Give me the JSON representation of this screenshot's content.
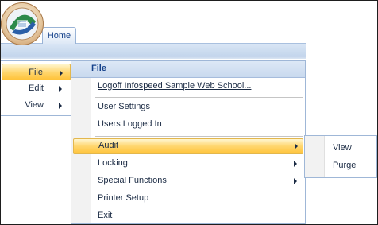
{
  "ribbon": {
    "tab_home_label": "Home"
  },
  "left_menu": {
    "items": [
      {
        "label": "File",
        "highlighted": true
      },
      {
        "label": "Edit",
        "highlighted": false
      },
      {
        "label": "View",
        "highlighted": false
      }
    ]
  },
  "dropdown": {
    "header": "File",
    "items": [
      {
        "label": "Logoff Infospeed Sample Web School...",
        "underline": true
      },
      {
        "label": "User Settings"
      },
      {
        "label": "Users Logged In"
      },
      {
        "label": "Audit",
        "highlighted": true,
        "submenu": true
      },
      {
        "label": "Locking",
        "submenu": true
      },
      {
        "label": "Special Functions",
        "submenu": true
      },
      {
        "label": "Printer Setup"
      },
      {
        "label": "Exit"
      }
    ]
  },
  "submenu": {
    "items": [
      {
        "label": "View"
      },
      {
        "label": "Purge"
      }
    ]
  },
  "colors": {
    "highlight_top": "#fff5cc",
    "highlight_bottom": "#ffc33a",
    "ribbon_band": "#c3d5ec",
    "menu_border": "#9fb7d7",
    "header_text": "#15428b"
  },
  "icons": {
    "app_orb": "application-orb-icon",
    "submenu_arrow": "chevron-right-icon"
  }
}
